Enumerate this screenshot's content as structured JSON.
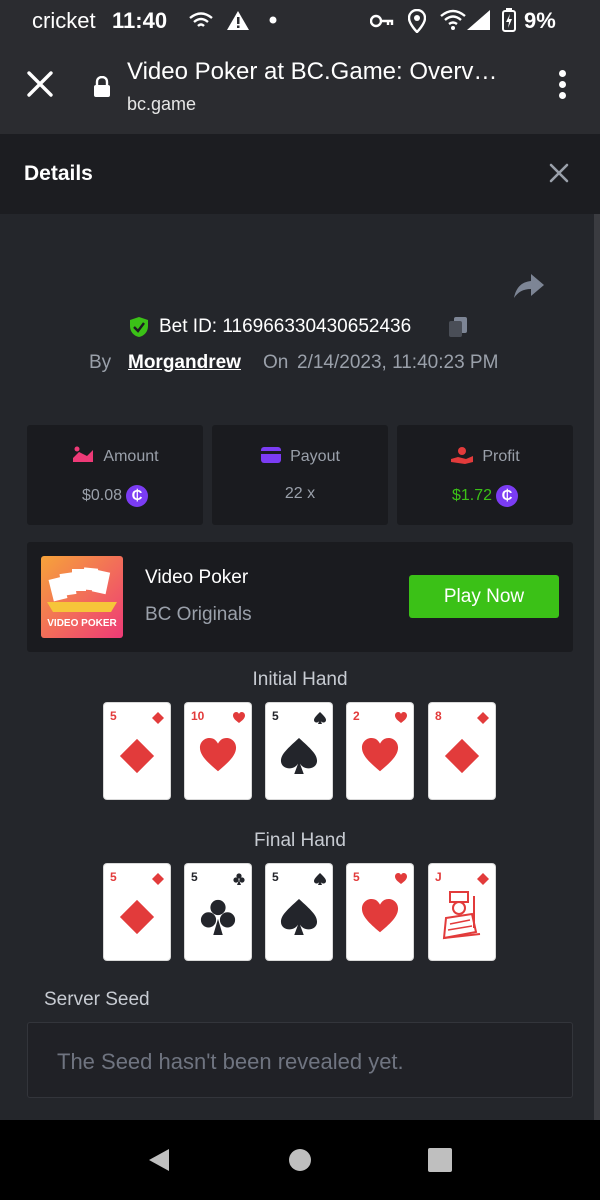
{
  "status_bar": {
    "carrier": "cricket",
    "time": "11:40",
    "battery": "9%"
  },
  "browser": {
    "title": "Video Poker at BC.Game: Overv…",
    "url": "bc.game"
  },
  "details": {
    "header": "Details",
    "bet_id_label": "Bet ID: 116966330430652436",
    "by_label": "By",
    "username": "Morgandrew",
    "on_label": "On",
    "timestamp": "2/14/2023, 11:40:23 PM"
  },
  "stats": {
    "amount_label": "Amount",
    "amount_value": "$0.08",
    "payout_label": "Payout",
    "payout_value": "22 x",
    "profit_label": "Profit",
    "profit_value": "$1.72",
    "coin_symbol": "₵"
  },
  "game": {
    "thumbnail_text": "VIDEO POKER",
    "name": "Video Poker",
    "provider": "BC Originals",
    "play_label": "Play Now"
  },
  "initial_hand": {
    "title": "Initial Hand",
    "cards": [
      {
        "rank": "5",
        "suit": "diamond"
      },
      {
        "rank": "10",
        "suit": "heart"
      },
      {
        "rank": "5",
        "suit": "spade"
      },
      {
        "rank": "2",
        "suit": "heart"
      },
      {
        "rank": "8",
        "suit": "diamond"
      }
    ]
  },
  "final_hand": {
    "title": "Final Hand",
    "cards": [
      {
        "rank": "5",
        "suit": "diamond"
      },
      {
        "rank": "5",
        "suit": "club"
      },
      {
        "rank": "5",
        "suit": "spade"
      },
      {
        "rank": "5",
        "suit": "heart"
      },
      {
        "rank": "J",
        "suit": "diamond"
      }
    ]
  },
  "server_seed": {
    "label": "Server Seed",
    "placeholder": "The Seed hasn't been revealed yet."
  },
  "colors": {
    "accent_green": "#3bc117",
    "card_red": "#e23b3b",
    "card_black": "#23252b",
    "coin_purple": "#7b3cf3"
  }
}
